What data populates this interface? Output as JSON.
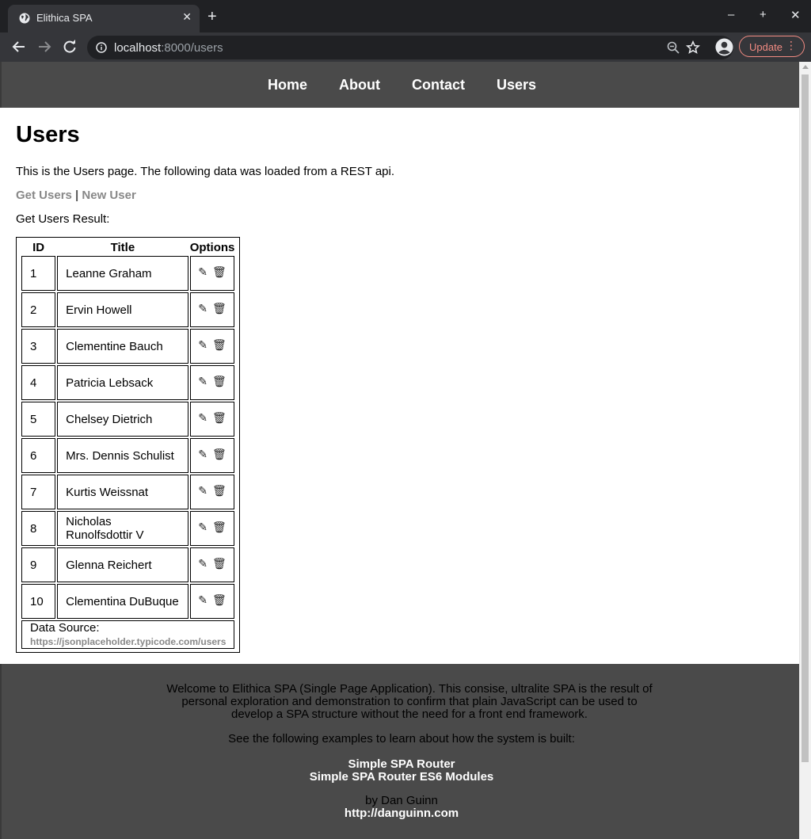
{
  "browser": {
    "tab_title": "Elithica SPA",
    "tab_close": "✕",
    "new_tab": "+",
    "window_minimize": "–",
    "window_maximize": "+",
    "window_close": "✕",
    "url_host": "localhost",
    "url_path": ":8000/users",
    "update_label": "Update",
    "menu_dots": "⋮"
  },
  "nav": {
    "items": [
      "Home",
      "About",
      "Contact",
      "Users"
    ]
  },
  "page": {
    "title": "Users",
    "intro": "This is the Users page. The following data was loaded from a REST api.",
    "get_users": "Get Users",
    "separator": "|",
    "new_user": "New User",
    "result_label": "Get Users Result:"
  },
  "table": {
    "headers": {
      "id": "ID",
      "title": "Title",
      "options": "Options"
    },
    "rows": [
      {
        "id": "1",
        "name": "Leanne Graham"
      },
      {
        "id": "2",
        "name": "Ervin Howell"
      },
      {
        "id": "3",
        "name": "Clementine Bauch"
      },
      {
        "id": "4",
        "name": "Patricia Lebsack"
      },
      {
        "id": "5",
        "name": "Chelsey Dietrich"
      },
      {
        "id": "6",
        "name": "Mrs. Dennis Schulist"
      },
      {
        "id": "7",
        "name": "Kurtis Weissnat"
      },
      {
        "id": "8",
        "name": "Nicholas Runolfsdottir V"
      },
      {
        "id": "9",
        "name": "Glenna Reichert"
      },
      {
        "id": "10",
        "name": "Clementina DuBuque"
      }
    ],
    "edit_icon": "✎",
    "delete_icon": "🗑",
    "source_label": "Data Source:",
    "source_url": "https://jsonplaceholder.typicode.com/users"
  },
  "footer": {
    "description": "Welcome to Elithica SPA (Single Page Application). This consise, ultralite SPA is the result of personal exploration and demonstration to confirm that plain JavaScript can be used to develop a SPA structure without the need for a front end framework.",
    "see_examples": "See the following examples to learn about how the system is built:",
    "link1": "Simple SPA Router",
    "link2": "Simple SPA Router ES6 Modules",
    "by": "by Dan Guinn",
    "site": "http://danguinn.com"
  },
  "colors": {
    "nav_bg": "#4a4a4a",
    "link_muted": "#888888",
    "update_accent": "#f28b82"
  },
  "icons": [
    "globe-icon",
    "back-arrow-icon",
    "forward-arrow-icon",
    "reload-icon",
    "info-icon",
    "zoom-icon",
    "star-icon",
    "account-icon",
    "edit-icon",
    "trash-icon"
  ]
}
